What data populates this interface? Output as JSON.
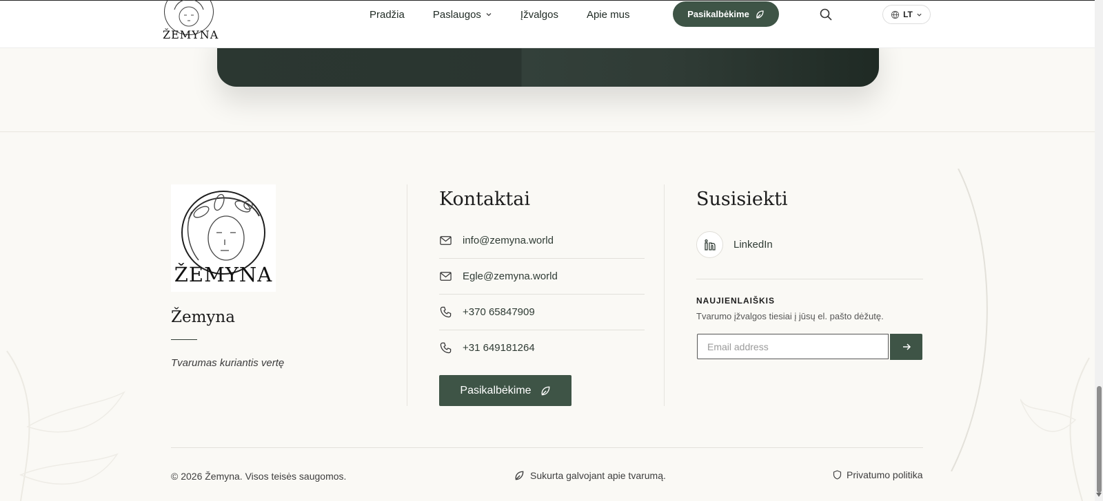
{
  "header": {
    "logo_text": "ŽEMYNA",
    "nav": [
      {
        "label": "Pradžia"
      },
      {
        "label": "Paslaugos"
      },
      {
        "label": "Įžvalgos"
      },
      {
        "label": "Apie mus"
      }
    ],
    "cta_label": "Pasikalbėkime",
    "lang_label": "LT"
  },
  "brand": {
    "logo_text": "ŽEMYNA",
    "name": "Žemyna",
    "tagline": "Tvarumas kuriantis vertę"
  },
  "contacts": {
    "title": "Kontaktai",
    "items": [
      {
        "type": "email",
        "value": "info@zemyna.world"
      },
      {
        "type": "email",
        "value": "Egle@zemyna.world"
      },
      {
        "type": "phone",
        "value": "+370 65847909"
      },
      {
        "type": "phone",
        "value": "+31 649181264"
      }
    ],
    "button_label": "Pasikalbėkime"
  },
  "connect": {
    "title": "Susisiekti",
    "linkedin_label": "LinkedIn",
    "newsletter_title": "NAUJIENLAIŠKIS",
    "newsletter_desc": "Tvarumo įžvalgos tiesiai į jūsų el. pašto dėžutę.",
    "email_placeholder": "Email address"
  },
  "bottom": {
    "copyright": "© 2026 Žemyna. Visos teisės saugomos.",
    "made_with": "Sukurta galvojant apie tvarumą.",
    "privacy": "Privatumo politika"
  },
  "colors": {
    "accent": "#3e5446",
    "background": "#faf9f5",
    "dark_card": "#2b3731"
  }
}
